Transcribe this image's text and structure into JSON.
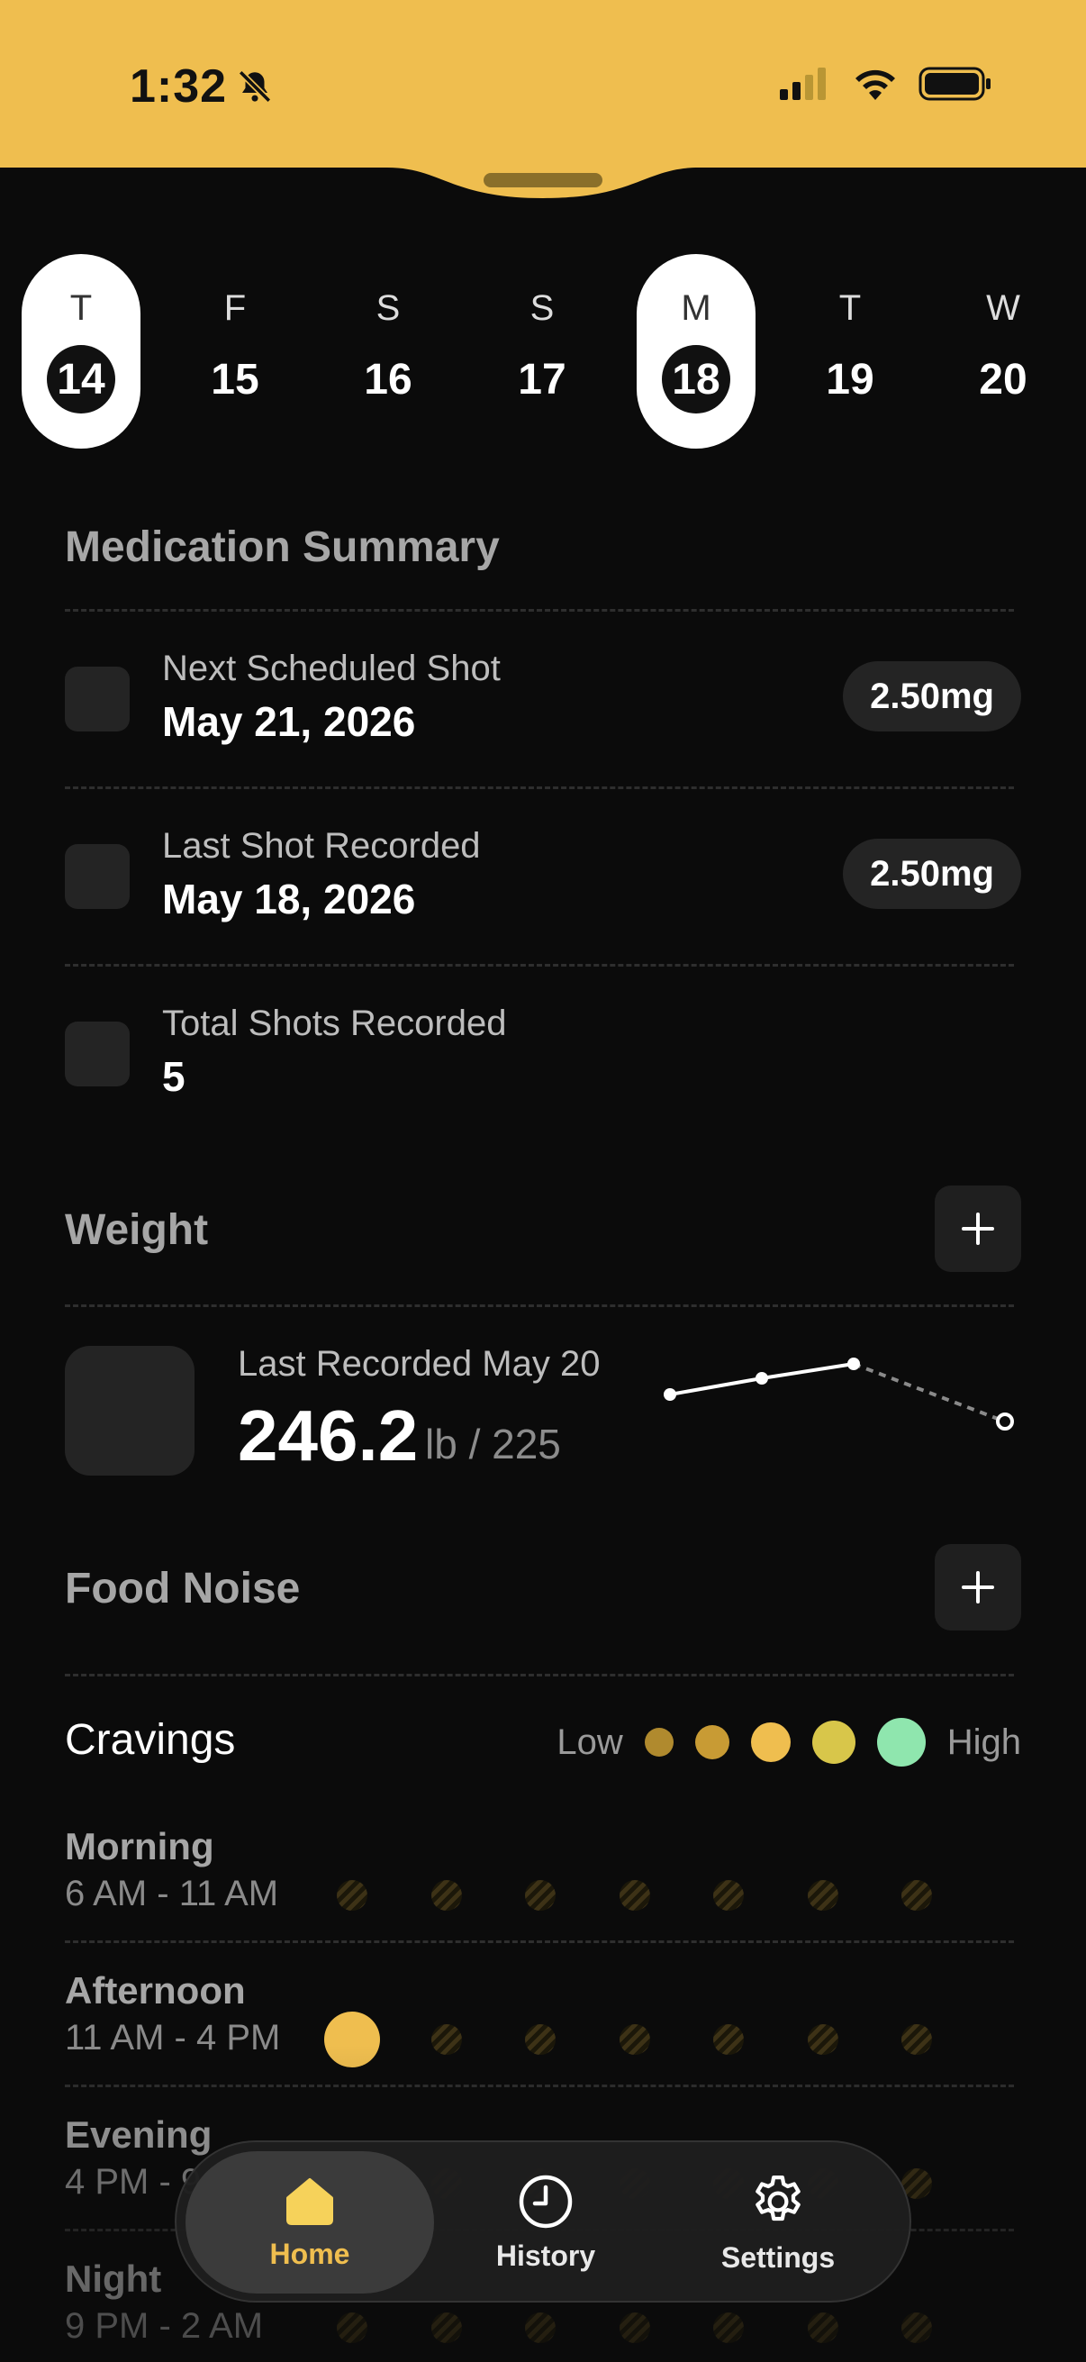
{
  "status": {
    "time": "1:32"
  },
  "days": [
    {
      "letter": "T",
      "num": "14",
      "highlight": true
    },
    {
      "letter": "F",
      "num": "15",
      "highlight": false
    },
    {
      "letter": "S",
      "num": "16",
      "highlight": false
    },
    {
      "letter": "S",
      "num": "17",
      "highlight": false
    },
    {
      "letter": "M",
      "num": "18",
      "highlight": true
    },
    {
      "letter": "T",
      "num": "19",
      "highlight": false
    },
    {
      "letter": "W",
      "num": "20",
      "highlight": false
    }
  ],
  "medication": {
    "title": "Medication Summary",
    "next": {
      "label": "Next Scheduled Shot",
      "value": "May 21, 2026",
      "dose": "2.50mg"
    },
    "last": {
      "label": "Last Shot Recorded",
      "value": "May 18, 2026",
      "dose": "2.50mg"
    },
    "total": {
      "label": "Total Shots Recorded",
      "value": "5"
    }
  },
  "weight": {
    "title": "Weight",
    "label": "Last Recorded May 20",
    "value": "246.2",
    "unit": "lb / 225"
  },
  "food_noise": {
    "title": "Food Noise",
    "cravings_title": "Cravings",
    "legend_low": "Low",
    "legend_high": "High",
    "legend_colors": [
      "#b08a2e",
      "#c89b34",
      "#efbe4f",
      "#d8c64a",
      "#8fe6ae"
    ],
    "rows": [
      {
        "name": "Morning",
        "range": "6 AM - 11 AM",
        "selected": null
      },
      {
        "name": "Afternoon",
        "range": "11 AM - 4 PM",
        "selected": 0
      },
      {
        "name": "Evening",
        "range": "4 PM - 9 PM",
        "selected": null
      },
      {
        "name": "Night",
        "range": "9 PM - 2 AM",
        "selected": null
      }
    ]
  },
  "tabs": [
    {
      "label": "Home",
      "icon": "home-icon",
      "active": true
    },
    {
      "label": "History",
      "icon": "clock-icon",
      "active": false
    },
    {
      "label": "Settings",
      "icon": "gear-icon",
      "active": false
    }
  ],
  "colors": {
    "accent": "#efbe4f",
    "background": "#0b0b0b"
  }
}
